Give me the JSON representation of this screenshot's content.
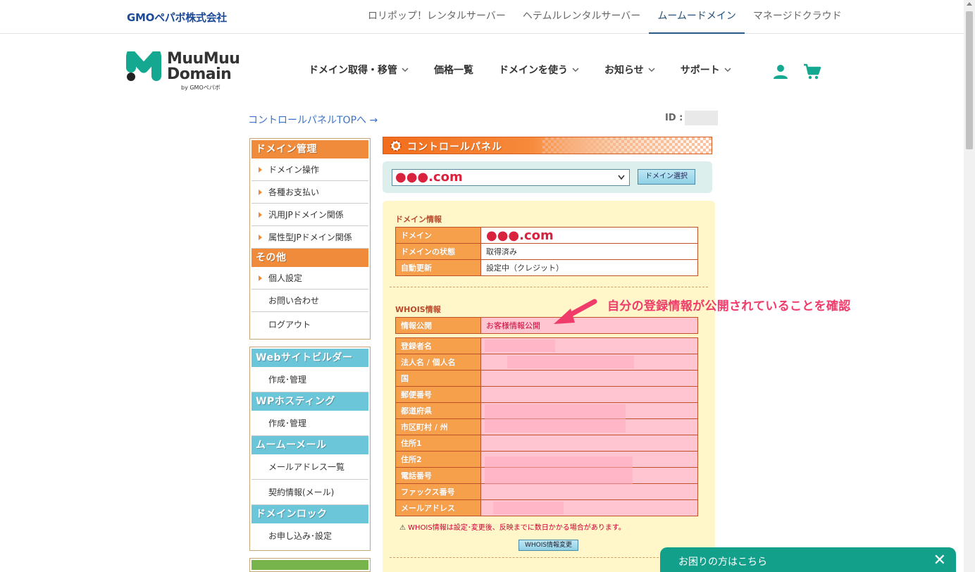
{
  "topbar": {
    "company": "GMOペパボ株式会社",
    "links": [
      {
        "label": "ロリポップ！レンタルサーバー",
        "active": false
      },
      {
        "label": "ヘテムルレンタルサーバー",
        "active": false
      },
      {
        "label": "ムームードメイン",
        "active": true
      },
      {
        "label": "マネージドクラウド",
        "active": false
      }
    ]
  },
  "header": {
    "logo_line1": "MuuMuu",
    "logo_line2": "Domain",
    "logo_by": "by GMOペパボ",
    "nav": [
      {
        "label": "ドメイン取得・移管",
        "dropdown": true
      },
      {
        "label": "価格一覧",
        "dropdown": false
      },
      {
        "label": "ドメインを使う",
        "dropdown": true
      },
      {
        "label": "お知らせ",
        "dropdown": true
      },
      {
        "label": "サポート",
        "dropdown": true
      }
    ],
    "icons": [
      "user-icon",
      "cart-icon"
    ],
    "accent_color": "#13a88f"
  },
  "control_panel": {
    "top_link": "コントロールパネルTOPへ →",
    "id_label": "ID :",
    "panel_title": "コントロールパネル",
    "domain_select_value": "●●●.com",
    "domain_select_button": "ドメイン選択"
  },
  "sidebar": {
    "box1": {
      "sections": [
        {
          "header": "ドメイン管理",
          "items": [
            "ドメイン操作",
            "各種お支払い",
            "汎用JPドメイン関係",
            "属性型JPドメイン関係"
          ]
        },
        {
          "header": "その他",
          "items": [
            "個人設定",
            "お問い合わせ",
            "ログアウト"
          ]
        }
      ]
    },
    "box2": {
      "sections": [
        {
          "header": "Webサイトビルダー",
          "items": [
            "作成･管理"
          ]
        },
        {
          "header": "WPホスティング",
          "items": [
            "作成･管理"
          ]
        },
        {
          "header": "ムームーメール",
          "items": [
            "メールアドレス一覧",
            "契約情報(メール)"
          ]
        },
        {
          "header": "ドメインロック",
          "items": [
            "お申し込み･設定"
          ]
        }
      ]
    }
  },
  "domain_info": {
    "title": "ドメイン情報",
    "rows": [
      {
        "key": "ドメイン",
        "value": "●●●.com"
      },
      {
        "key": "ドメインの状態",
        "value": "取得済み"
      },
      {
        "key": "自動更新",
        "value": "設定中（クレジット）"
      }
    ]
  },
  "whois": {
    "title": "WHOIS情報",
    "public_key": "情報公開",
    "public_value": "お客様情報公開",
    "fields": [
      "登録者名",
      "法人名 / 個人名",
      "国",
      "郵便番号",
      "都道府県",
      "市区町村 / 州",
      "住所1",
      "住所2",
      "電話番号",
      "ファックス番号",
      "メールアドレス"
    ],
    "note": "WHOIS情報は設定･変更後、反映までに数日かかる場合があります。",
    "edit_button": "WHOIS情報変更"
  },
  "annotation": "自分の登録情報が公開されていることを確認",
  "help_tab": {
    "label": "お困りの方はこちら",
    "close": "✕"
  }
}
